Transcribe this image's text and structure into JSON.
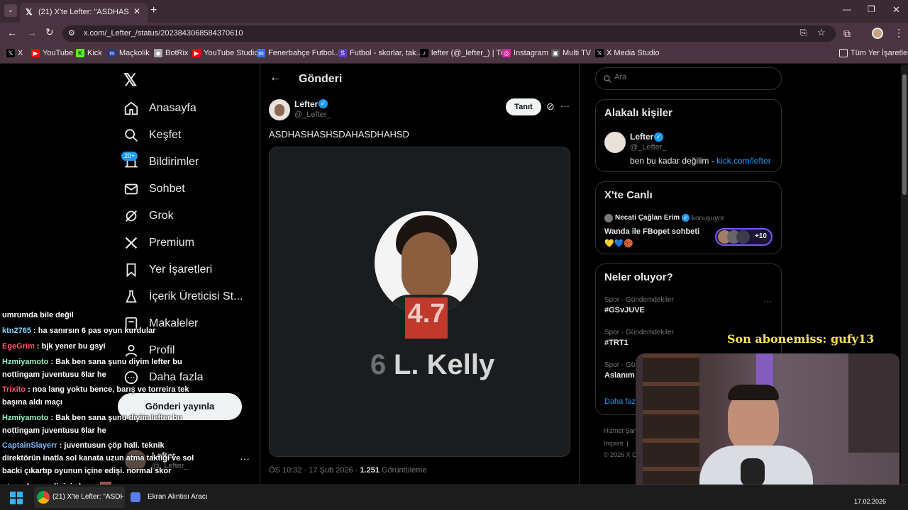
{
  "browser": {
    "tab_title": "(21) X'te Lefter: \"ASDHASHASHS",
    "url": "x.com/_Lefter_/status/2023843068584370610",
    "bookmarks": [
      "X",
      "YouTube",
      "Kick",
      "Maçkolik",
      "BotRix",
      "YouTube Studio",
      "Fenerbahçe Futbol...",
      "Futbol - skorlar, tak...",
      "lefter (@_lefter_) | Ti...",
      "Instagram",
      "Multi TV",
      "X Media Studio"
    ],
    "all_bookmarks": "Tüm Yer İşaretleri"
  },
  "nav": {
    "items": [
      "Anasayfa",
      "Keşfet",
      "Bildirimler",
      "Sohbet",
      "Grok",
      "Premium",
      "Yer İşaretleri",
      "İçerik Üreticisi St...",
      "Makaleler",
      "Profil",
      "Daha fazla"
    ],
    "notif_badge": "20+",
    "post_button": "Gönderi yayınla",
    "account_name": "Lefter",
    "account_handle": "@_Lefter_"
  },
  "post": {
    "header": "Gönderi",
    "author_name": "Lefter",
    "author_handle": "@_Lefter_",
    "follow_label": "Tanıt",
    "text": "ASDHASHASHSDAHASDHAHSD",
    "image": {
      "rating": "4.7",
      "number": "6",
      "player": "L. Kelly"
    },
    "time": "ÖS 10:32 · 17 Şub 2026 · ",
    "views_count": "1.251",
    "views_label": " Görüntüleme"
  },
  "sidebar": {
    "search_placeholder": "Ara",
    "relevant_title": "Alakalı kişiler",
    "relevant_name": "Lefter",
    "relevant_handle": "@_Lefter_",
    "relevant_bio": "ben bu kadar değilim - ",
    "relevant_link": "kick.com/lefter",
    "live_title": "X'te Canlı",
    "live_host": "Necati Çağlan Erim",
    "live_status": "konuşuyor",
    "live_topic": "Wanda ile FBopet sohbeti",
    "live_emoji": "💛💙🏀",
    "live_count": "+10",
    "trends_title": "Neler oluyor?",
    "trends": [
      {
        "meta": "Spor · Gündemdekiler",
        "tag": "#GSvJUVE"
      },
      {
        "meta": "Spor · Gündemdekiler",
        "tag": "#TRT1"
      },
      {
        "meta": "Spor · Gündemdekiler",
        "tag": "Aslanım"
      }
    ],
    "show_more": "Daha fazla",
    "footer1": "Hizmet Şart",
    "footer2": "Imprint  |",
    "footer3": "© 2026 X C"
  },
  "stream": {
    "sub_banner": "Son abonemiss: gufy13",
    "chat": [
      {
        "user": "",
        "color": "#ffffff",
        "msg": "umrumda bile değil"
      },
      {
        "user": "ktn2765",
        "color": "#7fd6ff",
        "msg": " : ha sanırsın 6 pas oyun kurdular"
      },
      {
        "user": "EgeGrim",
        "color": "#ff4f6b",
        "msg": " : bjk yener bu gsyi"
      },
      {
        "user": "Hzmiyamoto",
        "color": "#8cf5c8",
        "msg": " : Bak ben sana şunu diyim lefter bu"
      },
      {
        "user": "",
        "color": "#ffffff",
        "msg": "nottingam juventusu 6lar he"
      },
      {
        "user": "Trixito",
        "color": "#ff4f6b",
        "msg": " : noa lang yoktu bence, barış ve torreira tek"
      },
      {
        "user": "",
        "color": "#ffffff",
        "msg": "başına aldı maçı"
      },
      {
        "user": "Hzmiyamoto",
        "color": "#8cf5c8",
        "msg": " : Bak ben sana şunu diyim lefter bu"
      },
      {
        "user": "",
        "color": "#ffffff",
        "msg": "nottingam juventusu 6lar he"
      },
      {
        "user": "CaptainSlayerr",
        "color": "#7fb8ff",
        "msg": " : juventusun çöp hali. teknik"
      },
      {
        "user": "",
        "color": "#ffffff",
        "msg": "direktörün inatla sol kanata uzun atma taktiği ve sol"
      },
      {
        "user": "",
        "color": "#ffffff",
        "msg": "backi çıkartıp oyunun içine edişi. normal skor"
      },
      {
        "user": "nt_q",
        "color": "#c58cff",
        "msg": " : Avrupa ligini alazaz"
      }
    ]
  },
  "taskbar": {
    "app1": "(21) X'te Lefter: \"ASDHA",
    "app2": "Ekran Alıntısı Aracı",
    "date": "17.02.2026"
  }
}
